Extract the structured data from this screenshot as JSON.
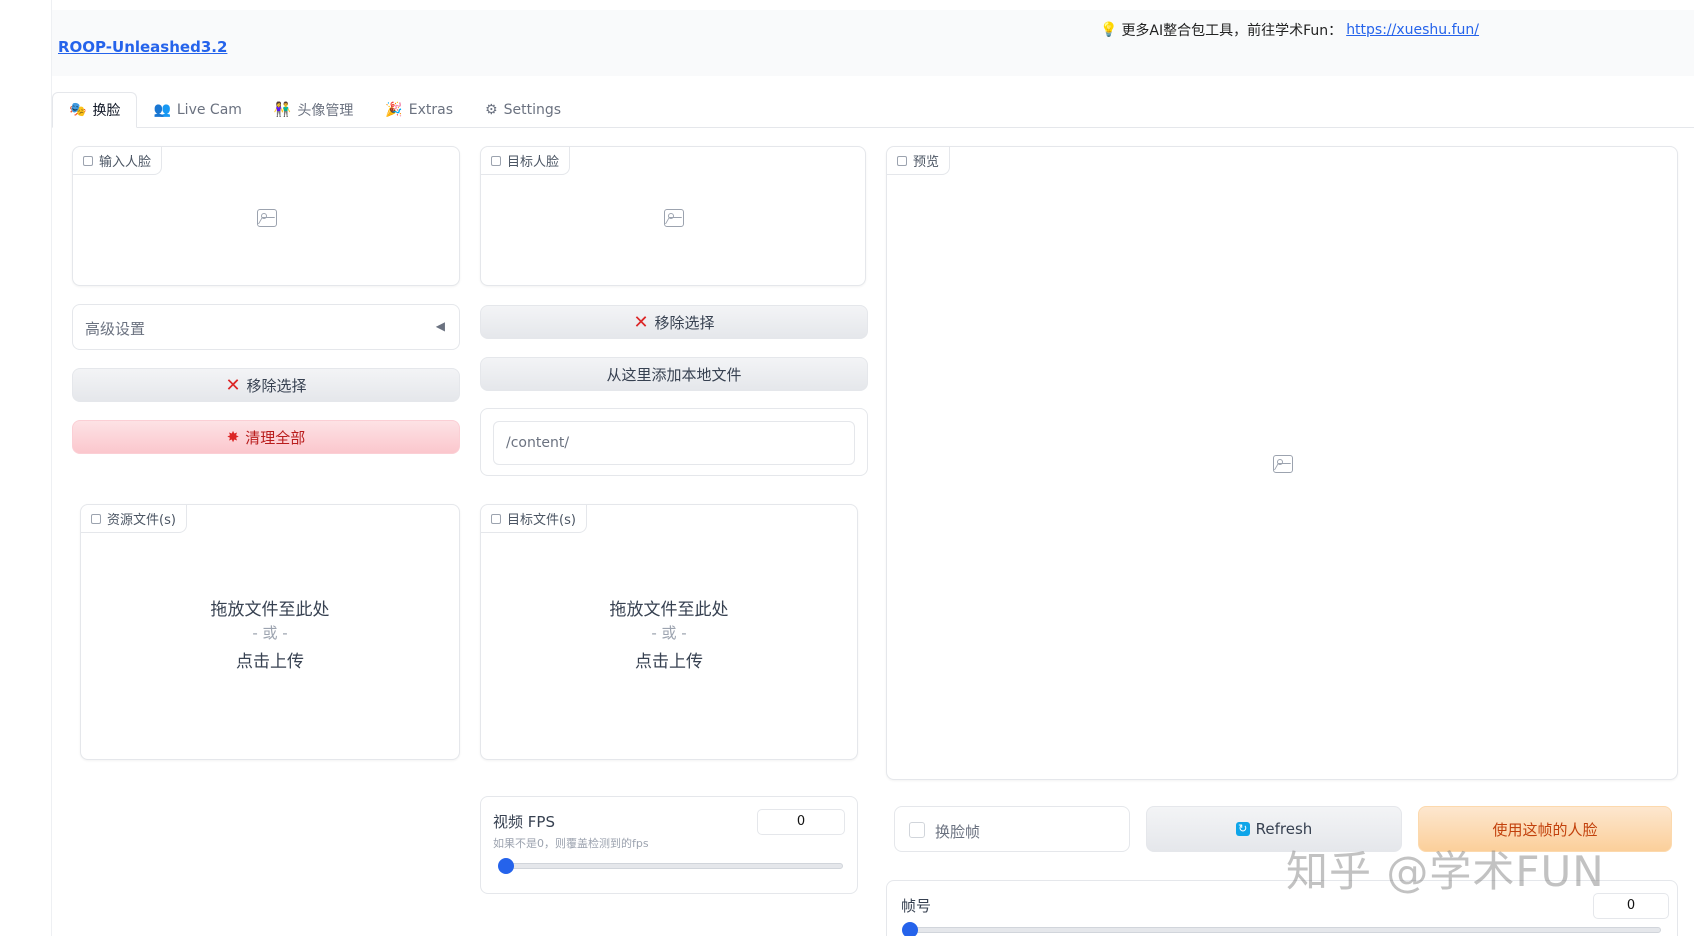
{
  "header": {
    "app_title": "ROOP-Unleashed3.2",
    "promo_text": "更多AI整合包工具，前往学术Fun：",
    "promo_link": "https://xueshu.fun/",
    "promo_icon": "lightbulb-icon"
  },
  "tabs": [
    {
      "label": "换脸",
      "icon": "masks-icon"
    },
    {
      "label": "Live Cam",
      "icon": "people-icon"
    },
    {
      "label": "头像管理",
      "icon": "faces-icon"
    },
    {
      "label": "Extras",
      "icon": "party-icon"
    },
    {
      "label": "Settings",
      "icon": "gear-icon"
    }
  ],
  "input_face": {
    "label": "输入人脸"
  },
  "target_face": {
    "label": "目标人脸"
  },
  "preview": {
    "label": "预览"
  },
  "advanced": {
    "label": "高级设置",
    "arrow": "◀"
  },
  "left_buttons": {
    "remove": "移除选择",
    "clear_all": "清理全部"
  },
  "middle_buttons": {
    "remove": "移除选择",
    "add_local": "从这里添加本地文件"
  },
  "path_input": {
    "value": "/content/"
  },
  "source_files": {
    "label": "资源文件(s)",
    "drop_text": "拖放文件至此处",
    "or_text": "- 或 -",
    "click_text": "点击上传"
  },
  "target_files": {
    "label": "目标文件(s)",
    "drop_text": "拖放文件至此处",
    "or_text": "- 或 -",
    "click_text": "点击上传"
  },
  "fps": {
    "title": "视频 FPS",
    "info": "如果不是0，则覆盖检测到的fps",
    "value": "0",
    "slider_level": 0
  },
  "swap_frame": {
    "label": "换脸帧",
    "checked": false
  },
  "refresh_button": {
    "label": "Refresh",
    "icon": "refresh-icon"
  },
  "use_face_button": {
    "label": "使用这帧的人脸"
  },
  "frame_number": {
    "title": "帧号",
    "value": "0",
    "slider_level": 0
  },
  "watermark": "知乎 @学术FUN",
  "colors": {
    "accent": "#2563eb",
    "danger": "#b91c1c",
    "primary": "#c2410c"
  }
}
